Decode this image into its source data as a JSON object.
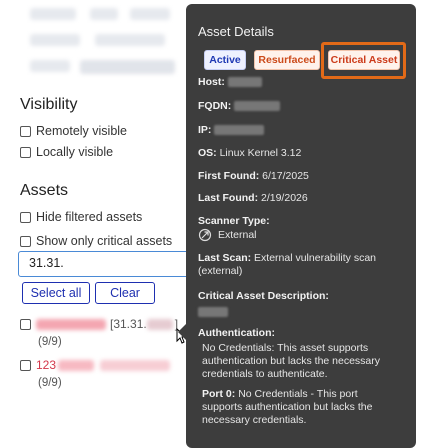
{
  "visibility": {
    "title": "Visibility",
    "options": [
      "Remotely visible",
      "Locally visible"
    ]
  },
  "assets": {
    "title": "Assets",
    "options": [
      "Hide filtered assets",
      "Show only critical assets"
    ],
    "filter_value": "31.31.",
    "select_all_label": "Select all",
    "clear_label": "Clear",
    "rows": [
      {
        "ip": "[31.31.",
        "ip_end": "]",
        "name_prefix": "",
        "count": "(9/9)"
      },
      {
        "ip": "",
        "ip_end": "",
        "name_prefix": "123",
        "count": "(9/9)"
      }
    ]
  },
  "popover": {
    "title": "Asset Details",
    "badges": [
      "Active",
      "Resurfaced",
      "Critical Asset"
    ],
    "host_label": "Host:",
    "fqdn_label": "FQDN:",
    "ip_label": "IP:",
    "os_label": "OS:",
    "os_value": "Linux Kernel 3.12",
    "first_found_label": "First Found:",
    "first_found_value": "6/17/2025",
    "last_found_label": "Last Found:",
    "last_found_value": "2/19/2026",
    "scanner_type_label": "Scanner Type:",
    "scanner_type_value": "External",
    "last_scan_label": "Last Scan:",
    "last_scan_value": "External vulnerability scan",
    "last_scan_value2": "(external)",
    "critical_desc_label": "Critical Asset Description:",
    "auth_label": "Authentication:",
    "auth_line1": "No Credentials: This asset supports",
    "auth_line2": "authentication but lacks the necessary",
    "auth_line3": "credentials to authenticate.",
    "port_label": "Port 0:",
    "port_line1": "No Credentials - This port",
    "port_line2": "supports authentication but lacks the",
    "port_line3": "necessary credentials."
  },
  "colors": {
    "accent_blue": "#1e2fb0",
    "popover_bg": "#3d3d3d",
    "critical_highlight": "#e26a18",
    "redacted_pink": "#f4a6b1"
  },
  "icons": {
    "scanner_type": "external-scan-icon"
  }
}
